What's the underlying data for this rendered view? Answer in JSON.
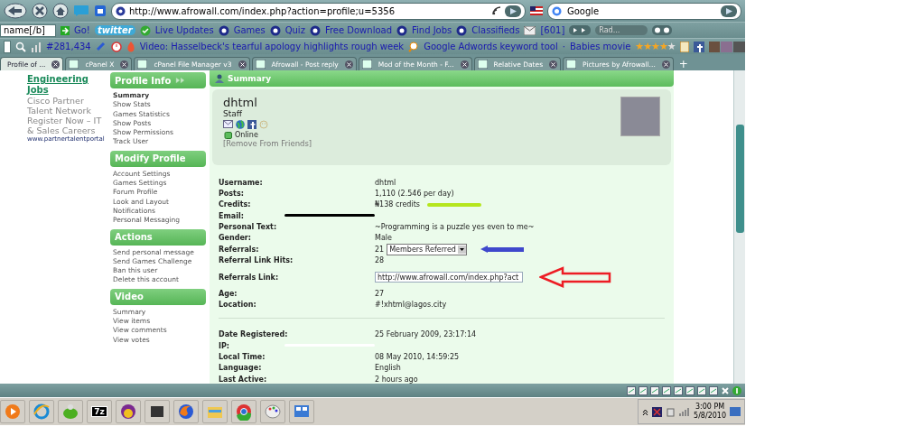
{
  "browser": {
    "address": "http://www.afrowall.com/index.php?action=profile;u=5356",
    "search_placeholder": "Google"
  },
  "toolbar": {
    "field_value": "name[/b]",
    "go": "Go!",
    "logo": "twitter",
    "links": [
      "Live Updates",
      "Games",
      "Quiz",
      "Free Download",
      "Find Jobs",
      "Classifieds"
    ],
    "mail_count": "[601]",
    "radio": "Rad..."
  },
  "toolbar2": {
    "count": "#281,434",
    "headline": "Video: Hasselbeck's tearful apology highlights rough week",
    "links": [
      "Google Adwords keyword tool",
      "Babies movie"
    ],
    "separator": "·",
    "stars": 4
  },
  "tabs": [
    {
      "label": "Profile of ...",
      "selected": true
    },
    {
      "label": "cPanel X",
      "selected": false
    },
    {
      "label": "cPanel File Manager v3",
      "selected": false
    },
    {
      "label": "Afrowall - Post reply",
      "selected": false
    },
    {
      "label": "Mod of the Month - F...",
      "selected": false
    },
    {
      "label": "Relative Dates",
      "selected": false
    },
    {
      "label": "Pictures by Afrowall...",
      "selected": false
    }
  ],
  "new_tab": "+",
  "ad": {
    "title": "Engineering Jobs",
    "lines": [
      "Cisco Partner Talent Network Register Now – IT & Sales Careers"
    ],
    "url": "www.partnertalentportal"
  },
  "sidebar": [
    {
      "title": "Profile Info",
      "items": [
        {
          "label": "Summary",
          "selected": true
        },
        {
          "label": "Show Stats",
          "selected": false
        },
        {
          "label": "Games Statistics",
          "selected": false
        },
        {
          "label": "Show Posts",
          "selected": false
        },
        {
          "label": "Show Permissions",
          "selected": false
        },
        {
          "label": "Track User",
          "selected": false
        }
      ]
    },
    {
      "title": "Modify Profile",
      "items": [
        {
          "label": "Account Settings",
          "selected": false
        },
        {
          "label": "Games Settings",
          "selected": false
        },
        {
          "label": "Forum Profile",
          "selected": false
        },
        {
          "label": "Look and Layout",
          "selected": false
        },
        {
          "label": "Notifications",
          "selected": false
        },
        {
          "label": "Personal Messaging",
          "selected": false
        }
      ]
    },
    {
      "title": "Actions",
      "items": [
        {
          "label": "Send personal message",
          "selected": false
        },
        {
          "label": "Send Games Challenge",
          "selected": false
        },
        {
          "label": "Ban this user",
          "selected": false
        },
        {
          "label": "Delete this account",
          "selected": false
        }
      ]
    },
    {
      "title": "Video",
      "items": [
        {
          "label": "Summary",
          "selected": false
        },
        {
          "label": "View items",
          "selected": false
        },
        {
          "label": "View comments",
          "selected": false
        },
        {
          "label": "View votes",
          "selected": false
        }
      ]
    }
  ],
  "summary": {
    "title": "Summary",
    "name": "dhtml",
    "group": "Staff",
    "online": true,
    "status": "Online",
    "remove_link": "[Remove From Friends]"
  },
  "details": [
    {
      "kind": "text",
      "label": "Username:",
      "value": "dhtml"
    },
    {
      "kind": "text",
      "label": "Posts:",
      "value": "1,110 (2.546 per day)"
    },
    {
      "kind": "text",
      "label": "Credits:",
      "value": "₦138 credits",
      "marker": {
        "kind": "highlight",
        "color": "#b5e61d"
      }
    },
    {
      "kind": "redacted",
      "label": "Email:",
      "marker": {
        "kind": "scribble",
        "color": "#000000"
      }
    },
    {
      "kind": "text",
      "label": "Personal Text:",
      "value": "~Programming is a puzzle yes even to me~"
    },
    {
      "kind": "text",
      "label": "Gender:",
      "value": "Male"
    },
    {
      "kind": "select",
      "label": "Referrals:",
      "count": "21",
      "value": "Members Referred",
      "marker": {
        "kind": "arrow",
        "color": "#3f48cc"
      }
    },
    {
      "kind": "text",
      "label": "Referral Link Hits:",
      "value": "28"
    },
    {
      "kind": "input",
      "label": "Referrals Link:",
      "value": "http://www.afrowall.com/index.php?act",
      "marker": {
        "kind": "outline-arrow",
        "color": "#ed1c24"
      }
    },
    {
      "kind": "text",
      "label": "Age:",
      "value": "27"
    },
    {
      "kind": "text",
      "label": "Location:",
      "value": "#!xhtml@lagos.city"
    },
    {
      "kind": "divider"
    },
    {
      "kind": "text",
      "label": "Date Registered:",
      "value": "25 February 2009, 23:17:14"
    },
    {
      "kind": "redacted",
      "label": "IP:",
      "marker": {
        "kind": "scribble",
        "color": "#ffffff"
      }
    },
    {
      "kind": "text",
      "label": "Local Time:",
      "value": "08 May 2010, 14:59:25"
    },
    {
      "kind": "text",
      "label": "Language:",
      "value": "English"
    },
    {
      "kind": "text",
      "label": "Last Active:",
      "value": "2 hours ago"
    }
  ],
  "taskbar": {
    "archiver_label": "7z",
    "time": "3:00 PM",
    "date": "5/8/2010"
  }
}
